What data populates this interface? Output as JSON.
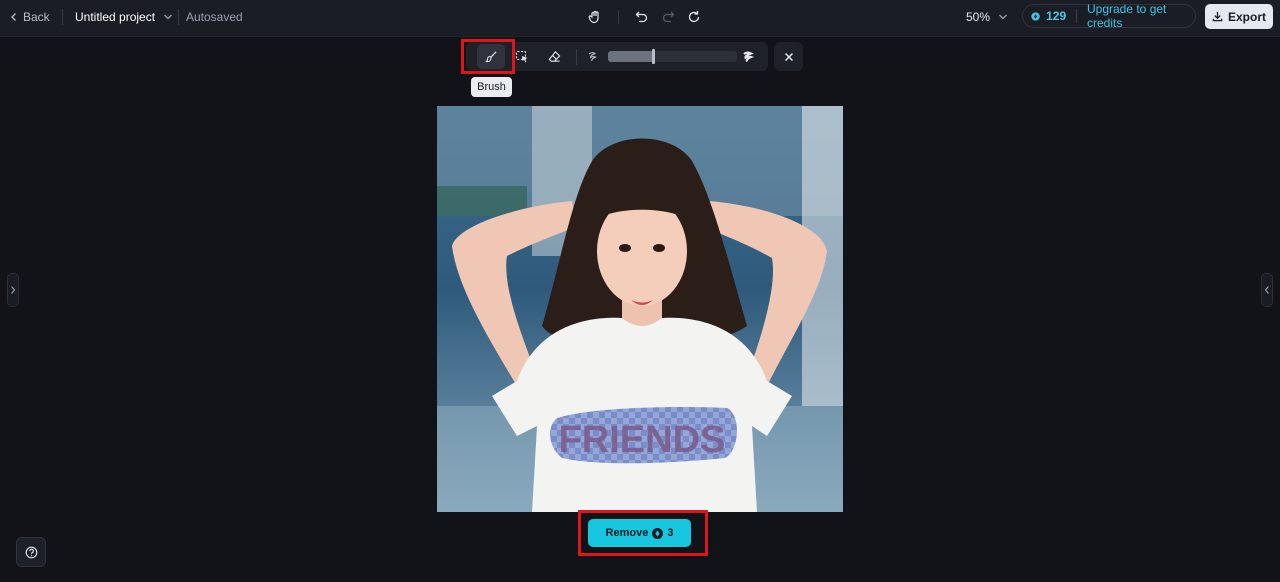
{
  "header": {
    "back_label": "Back",
    "project_title": "Untitled project",
    "autosave_status": "Autosaved",
    "zoom_level": "50%",
    "credits_count": "129",
    "upgrade_label": "Upgrade to get credits",
    "export_label": "Export"
  },
  "toolbar": {
    "tools": [
      {
        "name": "Brush",
        "icon": "brush-icon",
        "active": true
      },
      {
        "name": "lasso",
        "icon": "lasso-icon",
        "active": false
      },
      {
        "name": "eraser",
        "icon": "eraser-icon",
        "active": false
      }
    ],
    "brush_size_fraction": 0.35,
    "tooltip": "Brush"
  },
  "canvas": {
    "image_overlay_text": "FRIENDS"
  },
  "remove_button": {
    "label": "Remove",
    "cost": "3"
  },
  "colors": {
    "accent": "#17c7e0",
    "highlight": "#e0141b",
    "background": "#121318"
  }
}
